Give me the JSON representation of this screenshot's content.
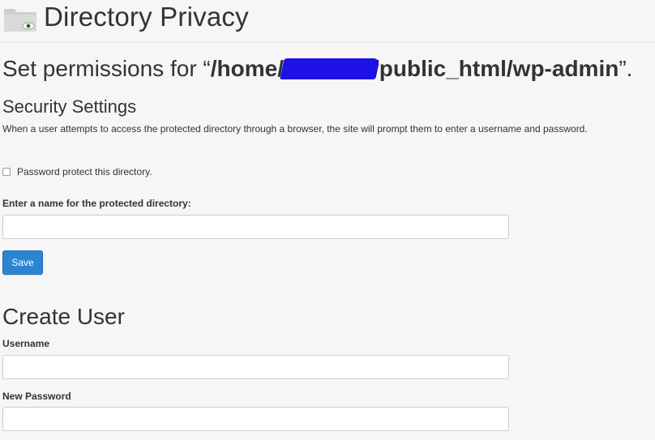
{
  "header": {
    "title": "Directory Privacy",
    "icon": "folder-eye-icon"
  },
  "permissions": {
    "prefix": "Set permissions for “",
    "path_start": "/home/",
    "path_end": "/public_html/wp-admin",
    "suffix": "”."
  },
  "security": {
    "heading": "Security Settings",
    "description": "When a user attempts to access the protected directory through a browser, the site will prompt them to enter a username and password.",
    "checkbox_label": "Password protect this directory.",
    "checkbox_checked": false,
    "name_label": "Enter a name for the protected directory:",
    "name_value": "",
    "save_label": "Save"
  },
  "create_user": {
    "heading": "Create User",
    "username_label": "Username",
    "username_value": "",
    "password_label": "New Password",
    "password_value": ""
  },
  "colors": {
    "accent": "#2b85d2",
    "redaction": "#1d11e6",
    "background": "#f6f6f6"
  }
}
